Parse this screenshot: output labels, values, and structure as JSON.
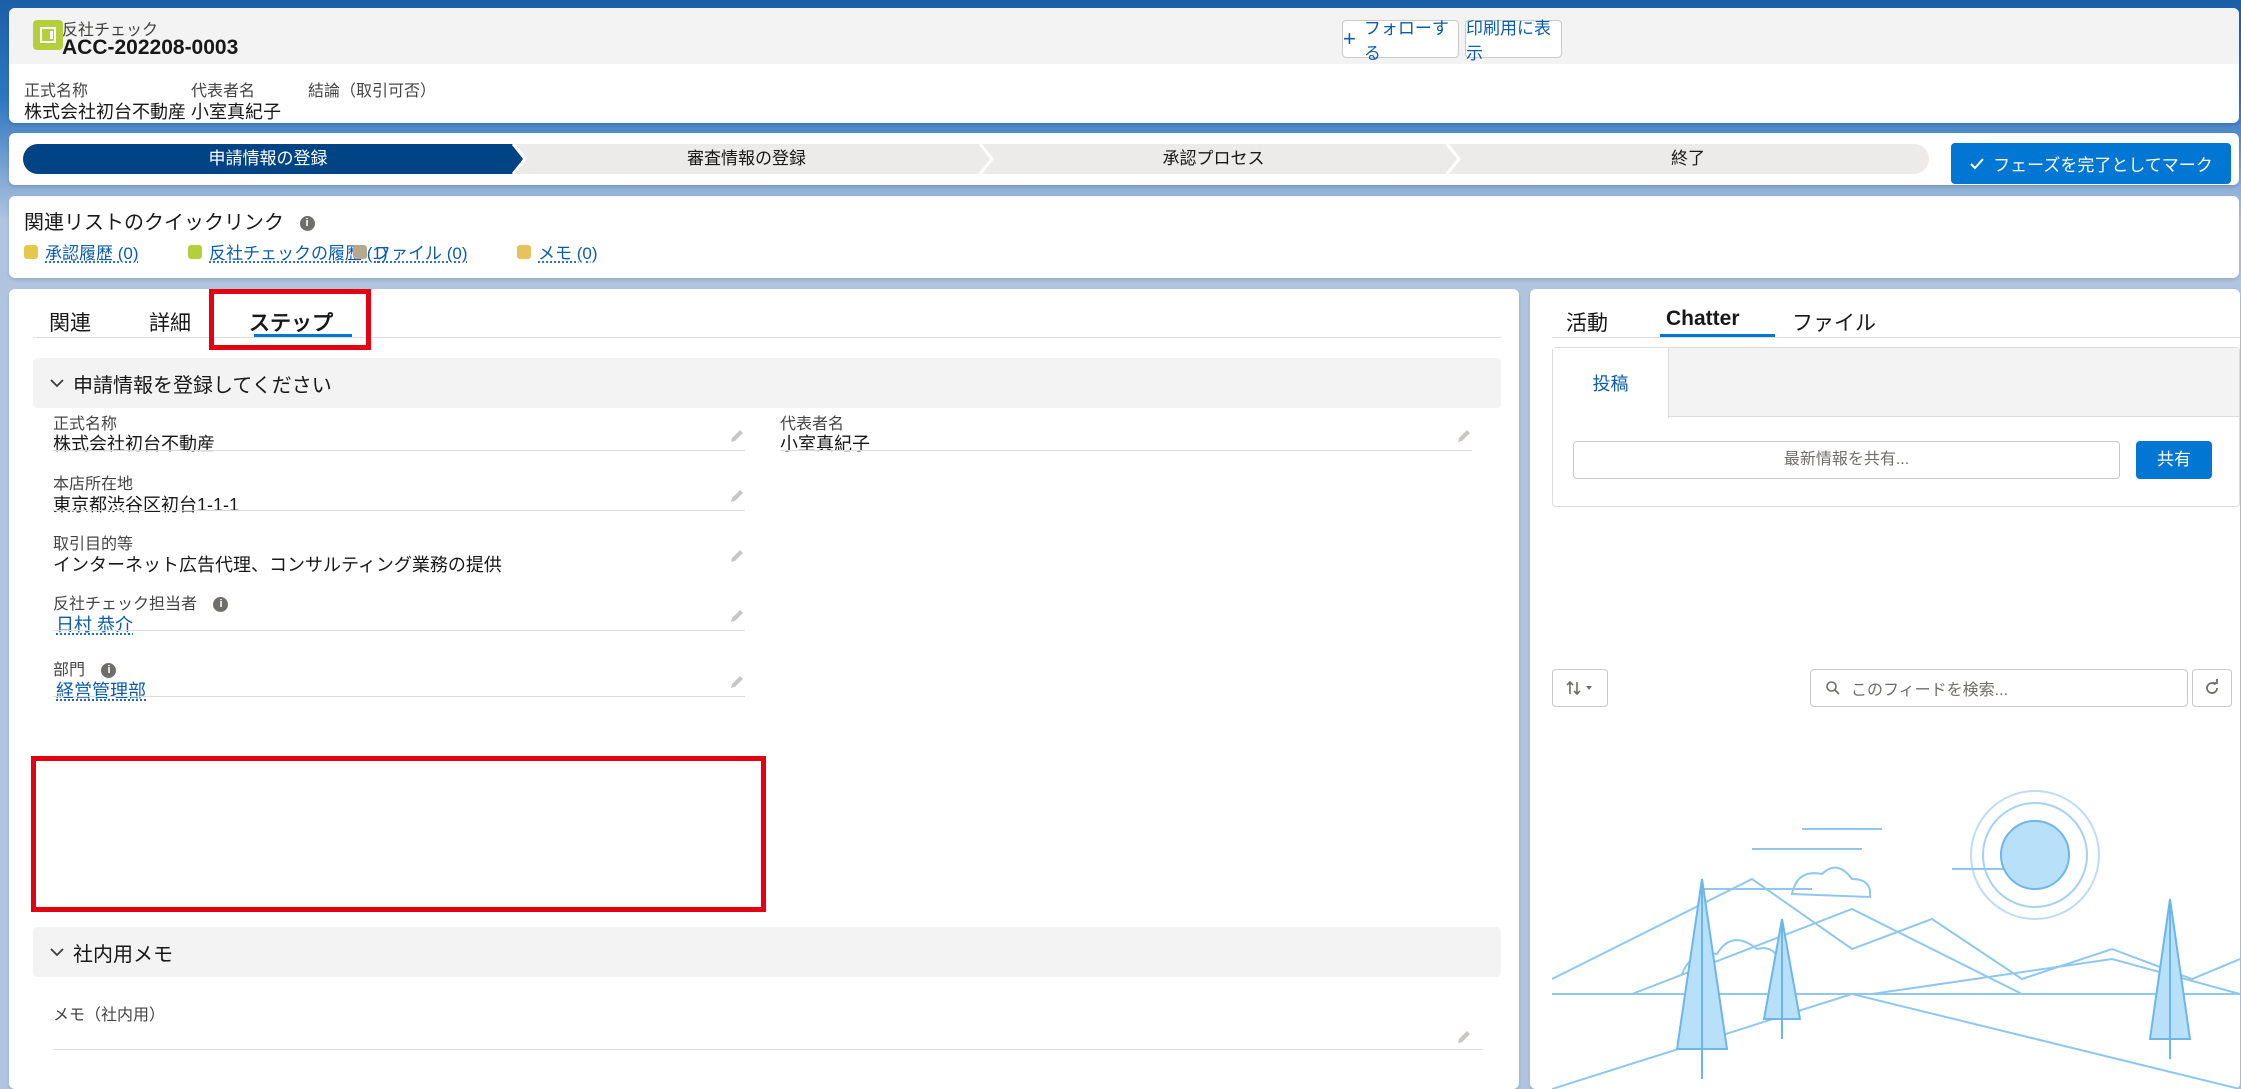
{
  "header": {
    "object_label": "反社チェック",
    "record_name": "ACC-202208-0003",
    "follow_button": "フォローする",
    "print_button": "印刷用に表示",
    "fields": [
      {
        "label": "正式名称",
        "value": "株式会社初台不動産"
      },
      {
        "label": "代表者名",
        "value": "小室真紀子"
      },
      {
        "label": "結論（取引可否）",
        "value": ""
      }
    ]
  },
  "path": {
    "steps": [
      "申請情報の登録",
      "審査情報の登録",
      "承認プロセス",
      "終了"
    ],
    "active_index": 0,
    "complete_button": "フェーズを完了としてマーク"
  },
  "quicklinks": {
    "title": "関連リストのクイックリンク",
    "items": [
      {
        "label": "承認履歴 (0)",
        "color": "#e4c84b"
      },
      {
        "label": "反社チェックの履歴 (1)",
        "color": "#b5cf3c"
      },
      {
        "label": "ファイル (0)",
        "color": "#b7a88d"
      },
      {
        "label": "メモ (0)",
        "color": "#e8c25a"
      }
    ]
  },
  "main": {
    "tabs": [
      "関連",
      "詳細",
      "ステップ"
    ],
    "active_tab": "ステップ",
    "section1": {
      "title": "申請情報を登録してください",
      "fields": {
        "official_name": {
          "label": "正式名称",
          "value": "株式会社初台不動産"
        },
        "representative": {
          "label": "代表者名",
          "value": "小室真紀子"
        },
        "address": {
          "label": "本店所在地",
          "value": "東京都渋谷区初台1-1-1"
        },
        "purpose": {
          "label": "取引目的等",
          "value": "インターネット広告代理、コンサルティング業務の提供"
        },
        "checker": {
          "label": "反社チェック担当者",
          "value": "日村 恭介"
        },
        "department": {
          "label": "部門",
          "value": "経営管理部"
        }
      }
    },
    "section2": {
      "title": "社内用メモ",
      "memo_label": "メモ（社内用）"
    }
  },
  "side": {
    "tabs": [
      "活動",
      "Chatter",
      "ファイル"
    ],
    "active_tab": "Chatter",
    "post_tab": "投稿",
    "share_placeholder": "最新情報を共有...",
    "share_button": "共有",
    "search_placeholder": "このフィードを検索..."
  },
  "colors": {
    "brand": "#0176d3",
    "path_active": "#014486",
    "highlight": "#e50012"
  }
}
